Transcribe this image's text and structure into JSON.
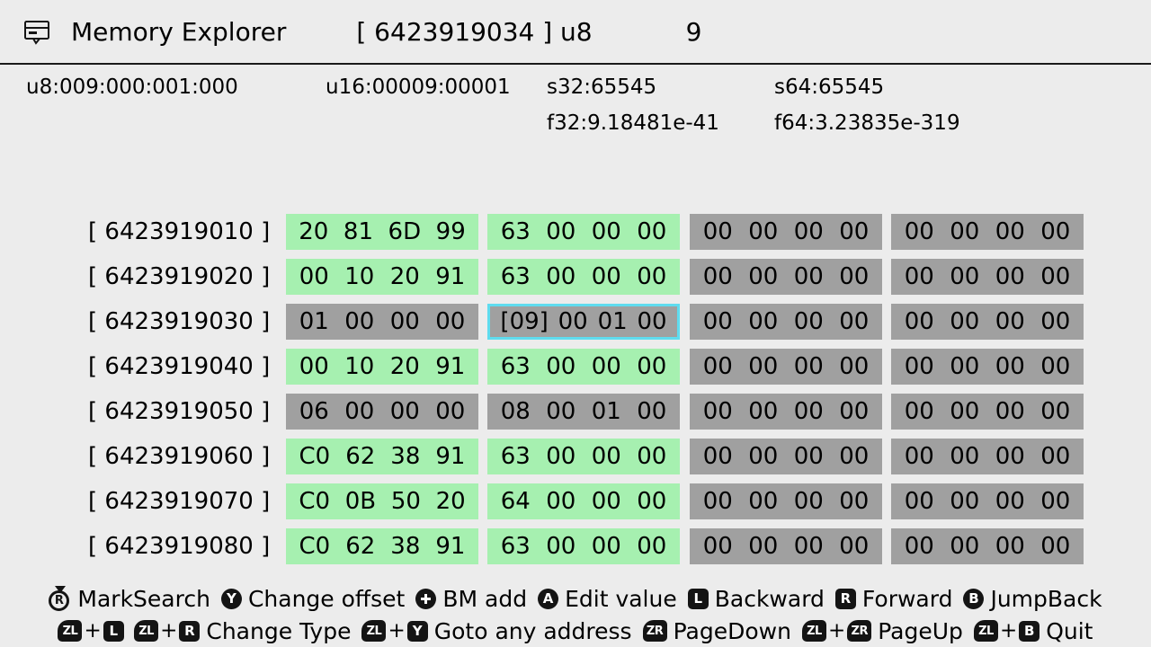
{
  "window": {
    "icon": "memory-card-icon",
    "title": "Memory Explorer",
    "cursor_address": "[ 6423919034 ]  u8",
    "cursor_value": "9"
  },
  "interpretation": {
    "u8": "u8:009:000:001:000",
    "u16": "u16:00009:00001",
    "s32": "s32:65545",
    "s64": "s64:65545",
    "f32": "f32:9.18481e-41",
    "f64": "f64:3.23835e-319"
  },
  "colors": {
    "background": "#ececec",
    "cell_changed": "#a6f0b0",
    "cell_normal": "#a0a0a0",
    "selection_border": "#5fdcef",
    "text": "#000000"
  },
  "hexdump": {
    "rows": [
      {
        "address": "[ 6423919010 ]",
        "groups": [
          {
            "style": "green",
            "selected": false,
            "bytes": [
              "20",
              "81",
              "6D",
              "99"
            ]
          },
          {
            "style": "green",
            "selected": false,
            "bytes": [
              "63",
              "00",
              "00",
              "00"
            ]
          },
          {
            "style": "gray",
            "selected": false,
            "bytes": [
              "00",
              "00",
              "00",
              "00"
            ]
          },
          {
            "style": "gray",
            "selected": false,
            "bytes": [
              "00",
              "00",
              "00",
              "00"
            ]
          }
        ]
      },
      {
        "address": "[ 6423919020 ]",
        "groups": [
          {
            "style": "green",
            "selected": false,
            "bytes": [
              "00",
              "10",
              "20",
              "91"
            ]
          },
          {
            "style": "green",
            "selected": false,
            "bytes": [
              "63",
              "00",
              "00",
              "00"
            ]
          },
          {
            "style": "gray",
            "selected": false,
            "bytes": [
              "00",
              "00",
              "00",
              "00"
            ]
          },
          {
            "style": "gray",
            "selected": false,
            "bytes": [
              "00",
              "00",
              "00",
              "00"
            ]
          }
        ]
      },
      {
        "address": "[ 6423919030 ]",
        "groups": [
          {
            "style": "gray",
            "selected": false,
            "bytes": [
              "01",
              "00",
              "00",
              "00"
            ]
          },
          {
            "style": "gray",
            "selected": true,
            "bytes": [
              "[09]",
              "00",
              "01",
              "00"
            ]
          },
          {
            "style": "gray",
            "selected": false,
            "bytes": [
              "00",
              "00",
              "00",
              "00"
            ]
          },
          {
            "style": "gray",
            "selected": false,
            "bytes": [
              "00",
              "00",
              "00",
              "00"
            ]
          }
        ]
      },
      {
        "address": "[ 6423919040 ]",
        "groups": [
          {
            "style": "green",
            "selected": false,
            "bytes": [
              "00",
              "10",
              "20",
              "91"
            ]
          },
          {
            "style": "green",
            "selected": false,
            "bytes": [
              "63",
              "00",
              "00",
              "00"
            ]
          },
          {
            "style": "gray",
            "selected": false,
            "bytes": [
              "00",
              "00",
              "00",
              "00"
            ]
          },
          {
            "style": "gray",
            "selected": false,
            "bytes": [
              "00",
              "00",
              "00",
              "00"
            ]
          }
        ]
      },
      {
        "address": "[ 6423919050 ]",
        "groups": [
          {
            "style": "gray",
            "selected": false,
            "bytes": [
              "06",
              "00",
              "00",
              "00"
            ]
          },
          {
            "style": "gray",
            "selected": false,
            "bytes": [
              "08",
              "00",
              "01",
              "00"
            ]
          },
          {
            "style": "gray",
            "selected": false,
            "bytes": [
              "00",
              "00",
              "00",
              "00"
            ]
          },
          {
            "style": "gray",
            "selected": false,
            "bytes": [
              "00",
              "00",
              "00",
              "00"
            ]
          }
        ]
      },
      {
        "address": "[ 6423919060 ]",
        "groups": [
          {
            "style": "green",
            "selected": false,
            "bytes": [
              "C0",
              "62",
              "38",
              "91"
            ]
          },
          {
            "style": "green",
            "selected": false,
            "bytes": [
              "63",
              "00",
              "00",
              "00"
            ]
          },
          {
            "style": "gray",
            "selected": false,
            "bytes": [
              "00",
              "00",
              "00",
              "00"
            ]
          },
          {
            "style": "gray",
            "selected": false,
            "bytes": [
              "00",
              "00",
              "00",
              "00"
            ]
          }
        ]
      },
      {
        "address": "[ 6423919070 ]",
        "groups": [
          {
            "style": "green",
            "selected": false,
            "bytes": [
              "C0",
              "0B",
              "50",
              "20"
            ]
          },
          {
            "style": "green",
            "selected": false,
            "bytes": [
              "64",
              "00",
              "00",
              "00"
            ]
          },
          {
            "style": "gray",
            "selected": false,
            "bytes": [
              "00",
              "00",
              "00",
              "00"
            ]
          },
          {
            "style": "gray",
            "selected": false,
            "bytes": [
              "00",
              "00",
              "00",
              "00"
            ]
          }
        ]
      },
      {
        "address": "[ 6423919080 ]",
        "groups": [
          {
            "style": "green",
            "selected": false,
            "bytes": [
              "C0",
              "62",
              "38",
              "91"
            ]
          },
          {
            "style": "green",
            "selected": false,
            "bytes": [
              "63",
              "00",
              "00",
              "00"
            ]
          },
          {
            "style": "gray",
            "selected": false,
            "bytes": [
              "00",
              "00",
              "00",
              "00"
            ]
          },
          {
            "style": "gray",
            "selected": false,
            "bytes": [
              "00",
              "00",
              "00",
              "00"
            ]
          }
        ]
      }
    ]
  },
  "footer": {
    "line1": [
      {
        "glyph": "right-stick-press",
        "glyph_text": "R",
        "label": "MarkSearch"
      },
      {
        "glyph": "button-y",
        "glyph_text": "Y",
        "label": "Change offset"
      },
      {
        "glyph": "button-plus",
        "glyph_text": "",
        "label": "BM add"
      },
      {
        "glyph": "button-a",
        "glyph_text": "A",
        "label": "Edit value"
      },
      {
        "glyph": "button-l",
        "glyph_text": "L",
        "label": "Backward"
      },
      {
        "glyph": "button-r",
        "glyph_text": "R",
        "label": "Forward"
      },
      {
        "glyph": "button-b",
        "glyph_text": "B",
        "label": "JumpBack"
      }
    ],
    "line2": [
      {
        "combo": [
          "ZL",
          "L",
          "ZL",
          "R"
        ],
        "label": "Change Type"
      },
      {
        "combo": [
          "ZL",
          "Y"
        ],
        "label": "Goto any address"
      },
      {
        "combo": [
          "ZR"
        ],
        "label": "PageDown"
      },
      {
        "combo": [
          "ZL",
          "ZR"
        ],
        "label": "PageUp"
      },
      {
        "combo": [
          "ZL",
          "B"
        ],
        "label": "Quit"
      }
    ]
  }
}
